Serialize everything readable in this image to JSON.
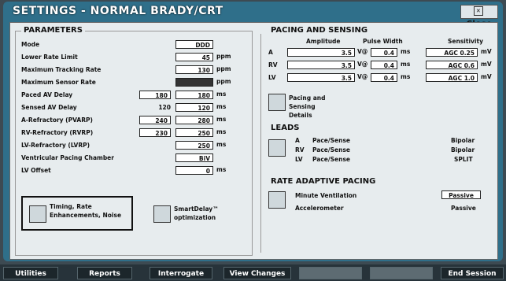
{
  "title": "SETTINGS - NORMAL BRADY/CRT",
  "close_label": "Close",
  "parameters": {
    "heading": "PARAMETERS",
    "rows": [
      {
        "label": "Mode",
        "value": "DDD",
        "unit": ""
      },
      {
        "label": "Lower Rate Limit",
        "value": "45",
        "unit": "ppm"
      },
      {
        "label": "Maximum Tracking Rate",
        "value": "130",
        "unit": "ppm"
      },
      {
        "label": "Maximum Sensor Rate",
        "value": "",
        "unit": "ppm"
      },
      {
        "label": "Paced AV Delay",
        "value_min": "180",
        "value": "180",
        "unit": "ms"
      },
      {
        "label": "Sensed AV Delay",
        "value_min": "120",
        "value": "120",
        "unit": "ms"
      },
      {
        "label": "A-Refractory (PVARP)",
        "value_min": "240",
        "value": "280",
        "unit": "ms"
      },
      {
        "label": "RV-Refractory (RVRP)",
        "value_min": "230",
        "value": "250",
        "unit": "ms"
      },
      {
        "label": "LV-Refractory (LVRP)",
        "value": "250",
        "unit": "ms"
      },
      {
        "label": "Ventricular Pacing Chamber",
        "value": "BiV",
        "unit": ""
      },
      {
        "label": "LV Offset",
        "value": "0",
        "unit": "ms"
      }
    ],
    "timing_btn": "Timing, Rate Enhancements, Noise",
    "smartdelay_btn": "SmartDelay™ optimization"
  },
  "pacing": {
    "heading": "PACING AND SENSING",
    "col_amplitude": "Amplitude",
    "col_pulse": "Pulse Width",
    "col_sensitivity": "Sensitivity",
    "rows": [
      {
        "chamber": "A",
        "amp": "3.5",
        "amp_unit": "V@",
        "pw": "0.4",
        "pw_unit": "ms",
        "sens": "AGC 0.25",
        "sens_unit": "mV"
      },
      {
        "chamber": "RV",
        "amp": "3.5",
        "amp_unit": "V@",
        "pw": "0.4",
        "pw_unit": "ms",
        "sens": "AGC 0.6",
        "sens_unit": "mV"
      },
      {
        "chamber": "LV",
        "amp": "3.5",
        "amp_unit": "V@",
        "pw": "0.4",
        "pw_unit": "ms",
        "sens": "AGC 1.0",
        "sens_unit": "mV"
      }
    ],
    "details_btn": "Pacing and Sensing Details"
  },
  "leads": {
    "heading": "LEADS",
    "rows": [
      {
        "chamber": "A",
        "mode": "Pace/Sense",
        "config": "Bipolar"
      },
      {
        "chamber": "RV",
        "mode": "Pace/Sense",
        "config": "Bipolar"
      },
      {
        "chamber": "LV",
        "mode": "Pace/Sense",
        "config": "SPLIT"
      }
    ]
  },
  "rate_adaptive": {
    "heading": "RATE ADAPTIVE PACING",
    "rows": [
      {
        "label": "Minute Ventilation",
        "value": "Passive"
      },
      {
        "label": "Accelerometer",
        "value": "Passive"
      }
    ]
  },
  "taskbar": {
    "utilities": "Utilities",
    "reports": "Reports",
    "interrogate": "Interrogate",
    "view_changes": "View Changes",
    "end_session": "End Session"
  }
}
